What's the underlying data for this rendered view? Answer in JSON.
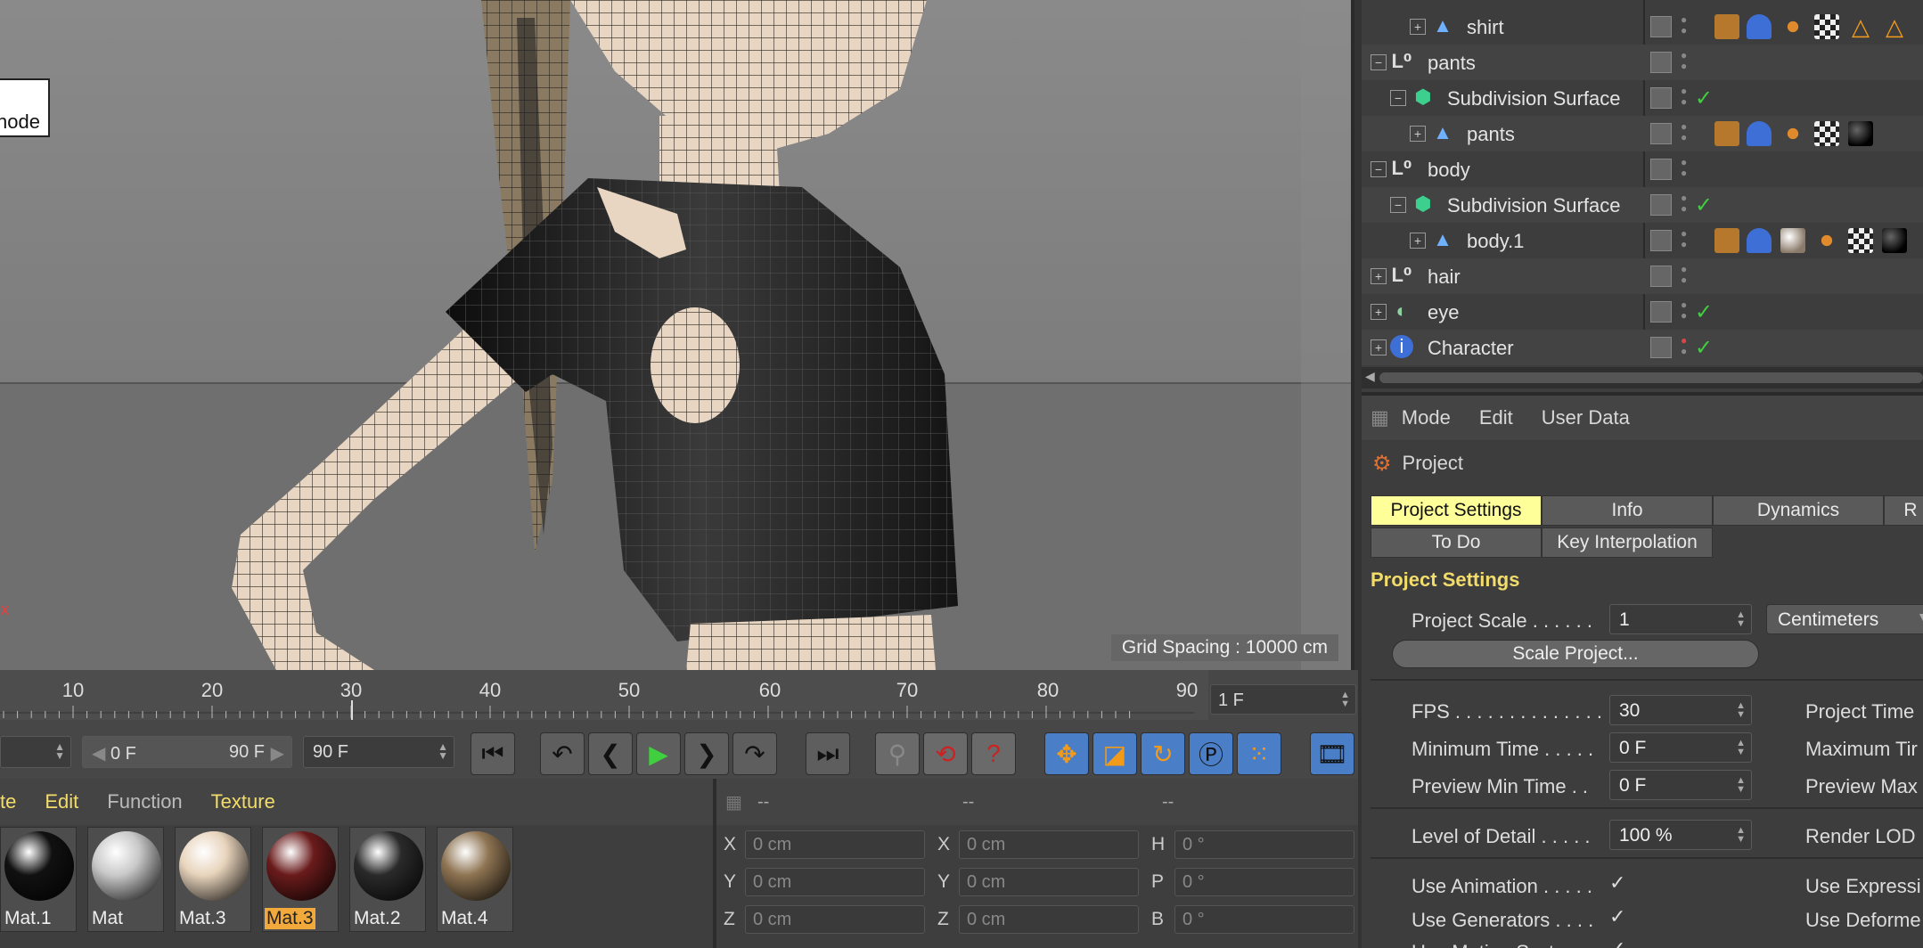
{
  "viewport": {
    "tooltip": "node",
    "grid_spacing": "Grid Spacing : 10000 cm"
  },
  "timeline": {
    "ticks": [
      "10",
      "20",
      "30",
      "40",
      "50",
      "60",
      "70",
      "80",
      "90"
    ],
    "current_frame": "1 F",
    "range_start": "0 F",
    "range_end": "90 F",
    "end_frame": "90 F"
  },
  "materials": {
    "menu": [
      "te",
      "Edit",
      "Function",
      "Texture"
    ],
    "items": [
      {
        "label": "Mat.1",
        "color": "#111111"
      },
      {
        "label": "Mat",
        "color": "#c9c9c9"
      },
      {
        "label": "Mat.3",
        "color": "#e8d4bc"
      },
      {
        "label": "Mat.3",
        "color": "#6a1b1b"
      },
      {
        "label": "Mat.2",
        "color": "#2a2a2a"
      },
      {
        "label": "Mat.4",
        "color": "#8e7452"
      }
    ]
  },
  "coords": {
    "headers": [
      "--",
      "--",
      "--"
    ],
    "rows": [
      {
        "a": "X",
        "av": "0 cm",
        "b": "X",
        "bv": "0 cm",
        "c": "H",
        "cv": "0 °"
      },
      {
        "a": "Y",
        "av": "0 cm",
        "b": "Y",
        "bv": "0 cm",
        "c": "P",
        "cv": "0 °"
      },
      {
        "a": "Z",
        "av": "0 cm",
        "b": "Z",
        "bv": "0 cm",
        "c": "B",
        "cv": "0 °"
      }
    ]
  },
  "objects": {
    "rows": [
      {
        "name": "shirt"
      },
      {
        "name": "pants"
      },
      {
        "name": "Subdivision Surface"
      },
      {
        "name": "pants"
      },
      {
        "name": "body"
      },
      {
        "name": "Subdivision Surface"
      },
      {
        "name": "body.1"
      },
      {
        "name": "hair"
      },
      {
        "name": "eye"
      },
      {
        "name": "Character"
      }
    ]
  },
  "attributes": {
    "menu": [
      "Mode",
      "Edit",
      "User Data"
    ],
    "title": "Project",
    "tabs": [
      "Project Settings",
      "Info",
      "Dynamics",
      "R",
      "To Do",
      "Key Interpolation"
    ],
    "section": "Project Settings",
    "project_scale_label": "Project Scale . . . . . .",
    "project_scale_value": "1",
    "unit": "Centimeters",
    "scale_button": "Scale Project...",
    "fps_label": "FPS . . . . . . . . . . . . . . .",
    "fps_value": "30",
    "project_time_label": "Project Time",
    "min_time_label": "Minimum Time . . . . .",
    "min_time_value": "0 F",
    "max_time_label": "Maximum Tir",
    "preview_min_label": "Preview Min Time . .",
    "preview_min_value": "0 F",
    "preview_max_label": "Preview Max",
    "lod_label": "Level of Detail . . . . .",
    "lod_value": "100 %",
    "render_lod_label": "Render LOD",
    "use_animation_label": "Use Animation . . . . .",
    "use_expression_label": "Use Expressi",
    "use_generators_label": "Use Generators . . . .",
    "use_deformers_label": "Use Deforme",
    "use_motion_label": "Use Motion System . .",
    "checkmark": "✓"
  }
}
